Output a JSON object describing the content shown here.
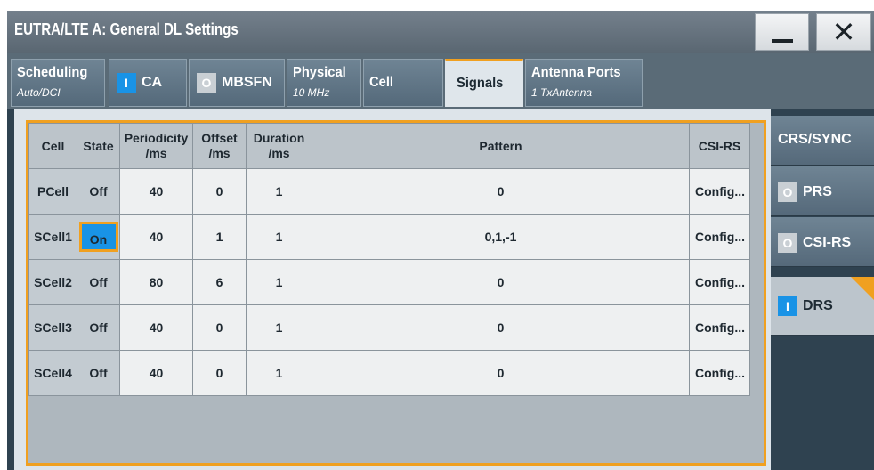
{
  "window": {
    "title": "EUTRA/LTE A: General DL Settings",
    "minimize_icon": "minimize-icon",
    "close_icon": "close-icon",
    "close_glyph": "✕"
  },
  "tabs": [
    {
      "label": "Scheduling",
      "sub": "Auto/DCI"
    },
    {
      "label": "CA",
      "toggle": "I",
      "toggle_state": "on"
    },
    {
      "label": "MBSFN",
      "toggle": "O",
      "toggle_state": "off"
    },
    {
      "label": "Physical",
      "sub": "10 MHz"
    },
    {
      "label": "Cell"
    },
    {
      "label": "Signals",
      "active": true
    },
    {
      "label": "Antenna Ports",
      "sub": "1 TxAntenna"
    }
  ],
  "table": {
    "headers": {
      "cell": "Cell",
      "state": "State",
      "periodicity_1": "Periodicity",
      "periodicity_2": "/ms",
      "offset_1": "Offset",
      "offset_2": "/ms",
      "duration_1": "Duration",
      "duration_2": "/ms",
      "pattern": "Pattern",
      "csirs": "CSI-RS"
    },
    "rows": [
      {
        "cell": "PCell",
        "state": "Off",
        "periodicity": "40",
        "offset": "0",
        "duration": "1",
        "pattern": "0",
        "csirs": "Config..."
      },
      {
        "cell": "SCell1",
        "state": "On",
        "periodicity": "40",
        "offset": "1",
        "duration": "1",
        "pattern": "0,1,-1",
        "csirs": "Config..."
      },
      {
        "cell": "SCell2",
        "state": "Off",
        "periodicity": "80",
        "offset": "6",
        "duration": "1",
        "pattern": "0",
        "csirs": "Config..."
      },
      {
        "cell": "SCell3",
        "state": "Off",
        "periodicity": "40",
        "offset": "0",
        "duration": "1",
        "pattern": "0",
        "csirs": "Config..."
      },
      {
        "cell": "SCell4",
        "state": "Off",
        "periodicity": "40",
        "offset": "0",
        "duration": "1",
        "pattern": "0",
        "csirs": "Config..."
      }
    ]
  },
  "side_nav": [
    {
      "label": "CRS/SYNC"
    },
    {
      "label": "PRS",
      "toggle": "O",
      "toggle_state": "off"
    },
    {
      "label": "CSI-RS",
      "toggle": "O",
      "toggle_state": "off"
    },
    {
      "label": "DRS",
      "toggle": "I",
      "toggle_state": "on",
      "active": true
    }
  ],
  "colors": {
    "accent": "#f0a020",
    "toggle_on": "#1993e6",
    "frame_bg": "#2f4250"
  }
}
